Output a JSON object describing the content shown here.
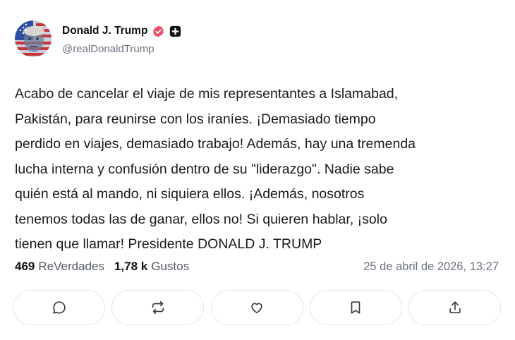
{
  "author": {
    "display_name": "Donald J. Trump",
    "handle": "@realDonaldTrump",
    "verified_icon": "verified-badge-icon",
    "plus_icon": "plus-square-icon"
  },
  "post": {
    "text": "Acabo de cancelar el viaje de mis representantes a Islamabad,\nPakistán, para reunirse con los iraníes. ¡Demasiado tiempo\nperdido en viajes, demasiado trabajo! Además, hay una tremenda\nlucha interna y confusión dentro de su \"liderazgo\". Nadie sabe\nquién está al mando, ni siquiera ellos. ¡Además, nosotros\ntenemos todas las de ganar, ellos no! Si quieren hablar, ¡solo\ntienen que llamar! Presidente DONALD J. TRUMP"
  },
  "stats": {
    "reposts_count": "469",
    "reposts_label": "ReVerdades",
    "likes_count": "1,78 k",
    "likes_label": "Gustos",
    "timestamp": "25 de abril de 2026, 13:27"
  },
  "actions": [
    {
      "icon": "reply-icon"
    },
    {
      "icon": "repost-icon"
    },
    {
      "icon": "like-heart-icon"
    },
    {
      "icon": "bookmark-icon"
    },
    {
      "icon": "share-icon"
    }
  ],
  "colors": {
    "verified": "#e8506a",
    "text": "#1a1a1a",
    "muted": "#6b7280",
    "border": "#e3e5e8"
  }
}
